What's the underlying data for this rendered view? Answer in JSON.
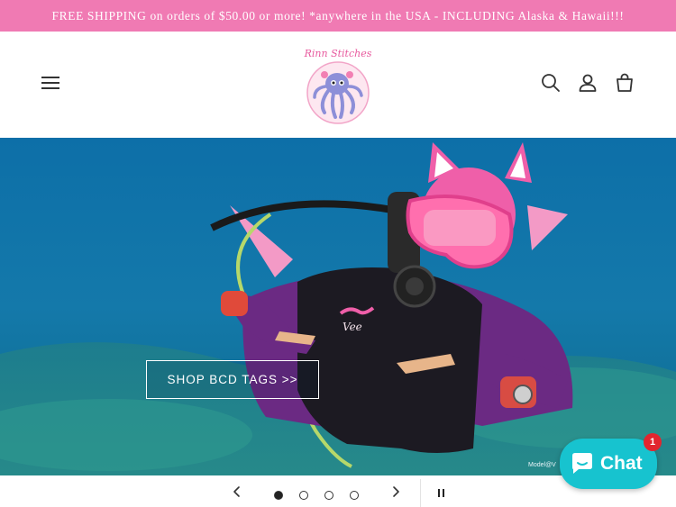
{
  "announcement": {
    "text": "FREE SHIPPING on orders of $50.00 or more!   *anywhere in the USA - INCLUDING Alaska & Hawaii!!!"
  },
  "header": {
    "logo_text": "Rinn Stitches",
    "icons": [
      "menu-icon",
      "search-icon",
      "account-icon",
      "cart-icon"
    ]
  },
  "hero": {
    "cta_label": "SHOP BCD TAGS >>",
    "tag_text": "Vee",
    "credit_text": "Model@V"
  },
  "slider": {
    "slide_count": 4,
    "active_slide": 1
  },
  "chat": {
    "label": "Chat",
    "badge_count": "1",
    "color": "#17c3cf"
  },
  "colors": {
    "announcement_bg": "#f07ab3",
    "accent_pink": "#e85a9e"
  }
}
